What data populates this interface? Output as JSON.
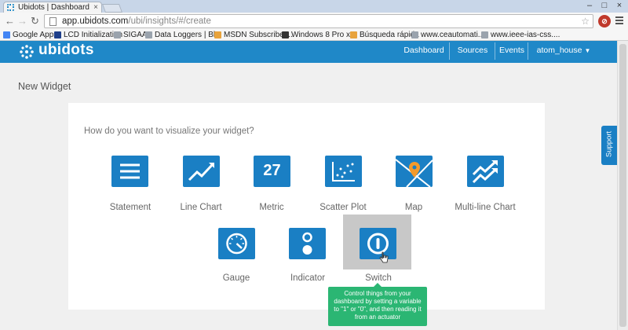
{
  "browser": {
    "tab_title": "Ubidots | Dashboard",
    "url_host": "app.ubidots.com",
    "url_path": "/ubi/insights/#/create",
    "bookmarks": [
      {
        "label": "Google Apps",
        "color": "#4285f4"
      },
      {
        "label": "LCD Initialization",
        "color": "#1e3f8a"
      },
      {
        "label": "SIGAA",
        "color": "#9aa3ad"
      },
      {
        "label": "Data Loggers | Bl...",
        "color": "#9aa3ad"
      },
      {
        "label": "MSDN Subscriber...",
        "color": "#e8a33c"
      },
      {
        "label": "Windows 8 Pro x...",
        "color": "#333333"
      },
      {
        "label": "Búsqueda rápida",
        "color": "#e8a33c"
      },
      {
        "label": "www.ceautomati...",
        "color": "#9aa3ad"
      },
      {
        "label": "www.ieee-ias-css....",
        "color": "#9aa3ad"
      }
    ]
  },
  "app": {
    "logo": "ubidots",
    "brand_color": "#1f88c8",
    "nav": {
      "dashboard": "Dashboard",
      "sources": "Sources",
      "events": "Events",
      "user": "atom_house"
    }
  },
  "page": {
    "title": "New Widget",
    "prompt": "How do you want to visualize your widget?",
    "support": "Support"
  },
  "widgets": [
    {
      "label": "Statement",
      "icon": "statement-icon"
    },
    {
      "label": "Line Chart",
      "icon": "line-chart-icon"
    },
    {
      "label": "Metric",
      "icon": "metric-icon",
      "value": "27"
    },
    {
      "label": "Scatter Plot",
      "icon": "scatter-plot-icon"
    },
    {
      "label": "Map",
      "icon": "map-icon"
    },
    {
      "label": "Multi-line Chart",
      "icon": "multi-line-chart-icon"
    },
    {
      "label": "Gauge",
      "icon": "gauge-icon"
    },
    {
      "label": "Indicator",
      "icon": "indicator-icon"
    },
    {
      "label": "Switch",
      "icon": "switch-icon"
    }
  ],
  "tooltip": {
    "text": "Control things from your dashboard by setting a variable to \"1\" or \"0\", and then reading it from an actuator",
    "color": "#2bb673"
  },
  "icon_color": "#1a7fc4"
}
